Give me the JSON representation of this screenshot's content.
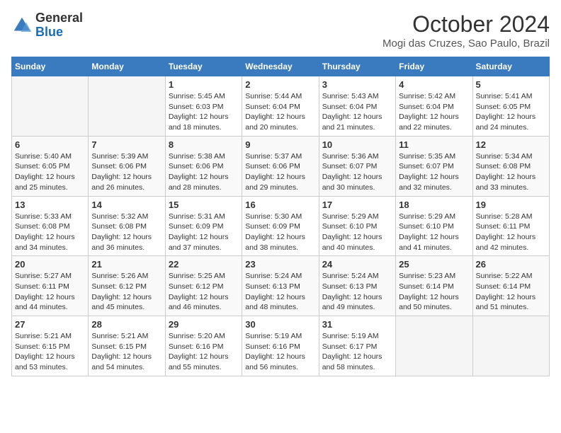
{
  "header": {
    "logo_line1": "General",
    "logo_line2": "Blue",
    "month": "October 2024",
    "location": "Mogi das Cruzes, Sao Paulo, Brazil"
  },
  "days_of_week": [
    "Sunday",
    "Monday",
    "Tuesday",
    "Wednesday",
    "Thursday",
    "Friday",
    "Saturday"
  ],
  "weeks": [
    [
      {
        "day": "",
        "info": ""
      },
      {
        "day": "",
        "info": ""
      },
      {
        "day": "1",
        "info": "Sunrise: 5:45 AM\nSunset: 6:03 PM\nDaylight: 12 hours\nand 18 minutes."
      },
      {
        "day": "2",
        "info": "Sunrise: 5:44 AM\nSunset: 6:04 PM\nDaylight: 12 hours\nand 20 minutes."
      },
      {
        "day": "3",
        "info": "Sunrise: 5:43 AM\nSunset: 6:04 PM\nDaylight: 12 hours\nand 21 minutes."
      },
      {
        "day": "4",
        "info": "Sunrise: 5:42 AM\nSunset: 6:04 PM\nDaylight: 12 hours\nand 22 minutes."
      },
      {
        "day": "5",
        "info": "Sunrise: 5:41 AM\nSunset: 6:05 PM\nDaylight: 12 hours\nand 24 minutes."
      }
    ],
    [
      {
        "day": "6",
        "info": "Sunrise: 5:40 AM\nSunset: 6:05 PM\nDaylight: 12 hours\nand 25 minutes."
      },
      {
        "day": "7",
        "info": "Sunrise: 5:39 AM\nSunset: 6:06 PM\nDaylight: 12 hours\nand 26 minutes."
      },
      {
        "day": "8",
        "info": "Sunrise: 5:38 AM\nSunset: 6:06 PM\nDaylight: 12 hours\nand 28 minutes."
      },
      {
        "day": "9",
        "info": "Sunrise: 5:37 AM\nSunset: 6:06 PM\nDaylight: 12 hours\nand 29 minutes."
      },
      {
        "day": "10",
        "info": "Sunrise: 5:36 AM\nSunset: 6:07 PM\nDaylight: 12 hours\nand 30 minutes."
      },
      {
        "day": "11",
        "info": "Sunrise: 5:35 AM\nSunset: 6:07 PM\nDaylight: 12 hours\nand 32 minutes."
      },
      {
        "day": "12",
        "info": "Sunrise: 5:34 AM\nSunset: 6:08 PM\nDaylight: 12 hours\nand 33 minutes."
      }
    ],
    [
      {
        "day": "13",
        "info": "Sunrise: 5:33 AM\nSunset: 6:08 PM\nDaylight: 12 hours\nand 34 minutes."
      },
      {
        "day": "14",
        "info": "Sunrise: 5:32 AM\nSunset: 6:08 PM\nDaylight: 12 hours\nand 36 minutes."
      },
      {
        "day": "15",
        "info": "Sunrise: 5:31 AM\nSunset: 6:09 PM\nDaylight: 12 hours\nand 37 minutes."
      },
      {
        "day": "16",
        "info": "Sunrise: 5:30 AM\nSunset: 6:09 PM\nDaylight: 12 hours\nand 38 minutes."
      },
      {
        "day": "17",
        "info": "Sunrise: 5:29 AM\nSunset: 6:10 PM\nDaylight: 12 hours\nand 40 minutes."
      },
      {
        "day": "18",
        "info": "Sunrise: 5:29 AM\nSunset: 6:10 PM\nDaylight: 12 hours\nand 41 minutes."
      },
      {
        "day": "19",
        "info": "Sunrise: 5:28 AM\nSunset: 6:11 PM\nDaylight: 12 hours\nand 42 minutes."
      }
    ],
    [
      {
        "day": "20",
        "info": "Sunrise: 5:27 AM\nSunset: 6:11 PM\nDaylight: 12 hours\nand 44 minutes."
      },
      {
        "day": "21",
        "info": "Sunrise: 5:26 AM\nSunset: 6:12 PM\nDaylight: 12 hours\nand 45 minutes."
      },
      {
        "day": "22",
        "info": "Sunrise: 5:25 AM\nSunset: 6:12 PM\nDaylight: 12 hours\nand 46 minutes."
      },
      {
        "day": "23",
        "info": "Sunrise: 5:24 AM\nSunset: 6:13 PM\nDaylight: 12 hours\nand 48 minutes."
      },
      {
        "day": "24",
        "info": "Sunrise: 5:24 AM\nSunset: 6:13 PM\nDaylight: 12 hours\nand 49 minutes."
      },
      {
        "day": "25",
        "info": "Sunrise: 5:23 AM\nSunset: 6:14 PM\nDaylight: 12 hours\nand 50 minutes."
      },
      {
        "day": "26",
        "info": "Sunrise: 5:22 AM\nSunset: 6:14 PM\nDaylight: 12 hours\nand 51 minutes."
      }
    ],
    [
      {
        "day": "27",
        "info": "Sunrise: 5:21 AM\nSunset: 6:15 PM\nDaylight: 12 hours\nand 53 minutes."
      },
      {
        "day": "28",
        "info": "Sunrise: 5:21 AM\nSunset: 6:15 PM\nDaylight: 12 hours\nand 54 minutes."
      },
      {
        "day": "29",
        "info": "Sunrise: 5:20 AM\nSunset: 6:16 PM\nDaylight: 12 hours\nand 55 minutes."
      },
      {
        "day": "30",
        "info": "Sunrise: 5:19 AM\nSunset: 6:16 PM\nDaylight: 12 hours\nand 56 minutes."
      },
      {
        "day": "31",
        "info": "Sunrise: 5:19 AM\nSunset: 6:17 PM\nDaylight: 12 hours\nand 58 minutes."
      },
      {
        "day": "",
        "info": ""
      },
      {
        "day": "",
        "info": ""
      }
    ]
  ]
}
